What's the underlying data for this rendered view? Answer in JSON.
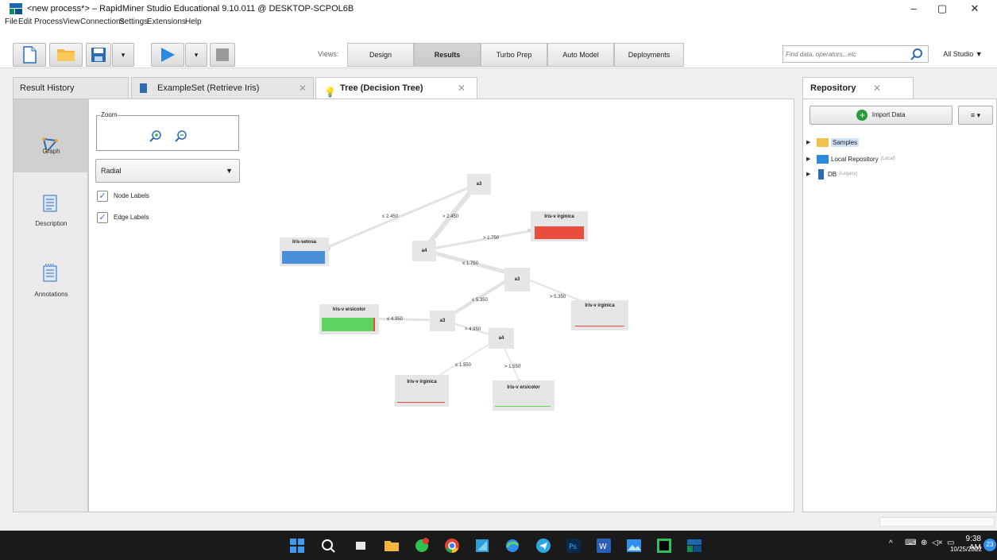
{
  "window": {
    "title": "<new process*> – RapidMiner Studio Educational 9.10.011 @ DESKTOP-SCPOL6B",
    "minimize": "–",
    "maximize": "▢",
    "close": "✕"
  },
  "menu": [
    "File",
    "Edit",
    "Process",
    "View",
    "Connections",
    "Settings",
    "Extensions",
    "Help"
  ],
  "toolbar": {
    "views_label": "Views:",
    "views": [
      "Design",
      "Results",
      "Turbo Prep",
      "Auto Model",
      "Deployments"
    ],
    "active_view": "Results",
    "search_placeholder": "Find data, operators...etc",
    "studio_mode": "All Studio ▼"
  },
  "tabs": [
    {
      "label": "Result History"
    },
    {
      "label": "ExampleSet (Retrieve Iris)"
    },
    {
      "label": "Tree (Decision Tree)"
    }
  ],
  "sidebar": [
    {
      "label": "Graph",
      "icon": "graph-icon"
    },
    {
      "label": "Description",
      "icon": "description-icon"
    },
    {
      "label": "Annotations",
      "icon": "annotations-icon"
    }
  ],
  "controls": {
    "zoom_label": "Zoom",
    "layout": "Radial",
    "node_labels": "Node Labels",
    "edge_labels": "Edge Labels"
  },
  "tree": {
    "nodes": [
      {
        "id": "n1",
        "label": "a3"
      },
      {
        "id": "n2",
        "label": "Iris-setosa"
      },
      {
        "id": "n3",
        "label": "a4"
      },
      {
        "id": "n4",
        "label": "Iris-v irginica"
      },
      {
        "id": "n5",
        "label": "a3"
      },
      {
        "id": "n6",
        "label": "Iris-v irginica"
      },
      {
        "id": "n7",
        "label": "a3"
      },
      {
        "id": "n8",
        "label": "Iris-v ersicolor"
      },
      {
        "id": "n9",
        "label": "a4"
      },
      {
        "id": "n10",
        "label": "Iris-v irginica"
      },
      {
        "id": "n11",
        "label": "Iris-v ersicolor"
      }
    ],
    "edges": [
      "≤ 2.450",
      "> 2.450",
      "> 1.750",
      "≤ 1.750",
      "> 5.350",
      "≤ 5.350",
      "≤ 4.950",
      "> 4.950",
      "≤ 1.550",
      "> 1.550"
    ]
  },
  "repository": {
    "tab": "Repository",
    "import_label": "Import Data",
    "menu_label": "≡ ▾",
    "items": [
      {
        "label": "Samples",
        "muted": ""
      },
      {
        "label": "Local Repository",
        "muted": "(Local)"
      },
      {
        "label": "DB",
        "muted": "(Legacy)"
      }
    ]
  },
  "taskbar": {
    "time": "9:38 AM",
    "date": "10/25/2022",
    "notifications": "23"
  },
  "colors": {
    "setosa": "#4a90d9",
    "virginica": "#e74c3c",
    "versicolor": "#5fd35f"
  }
}
